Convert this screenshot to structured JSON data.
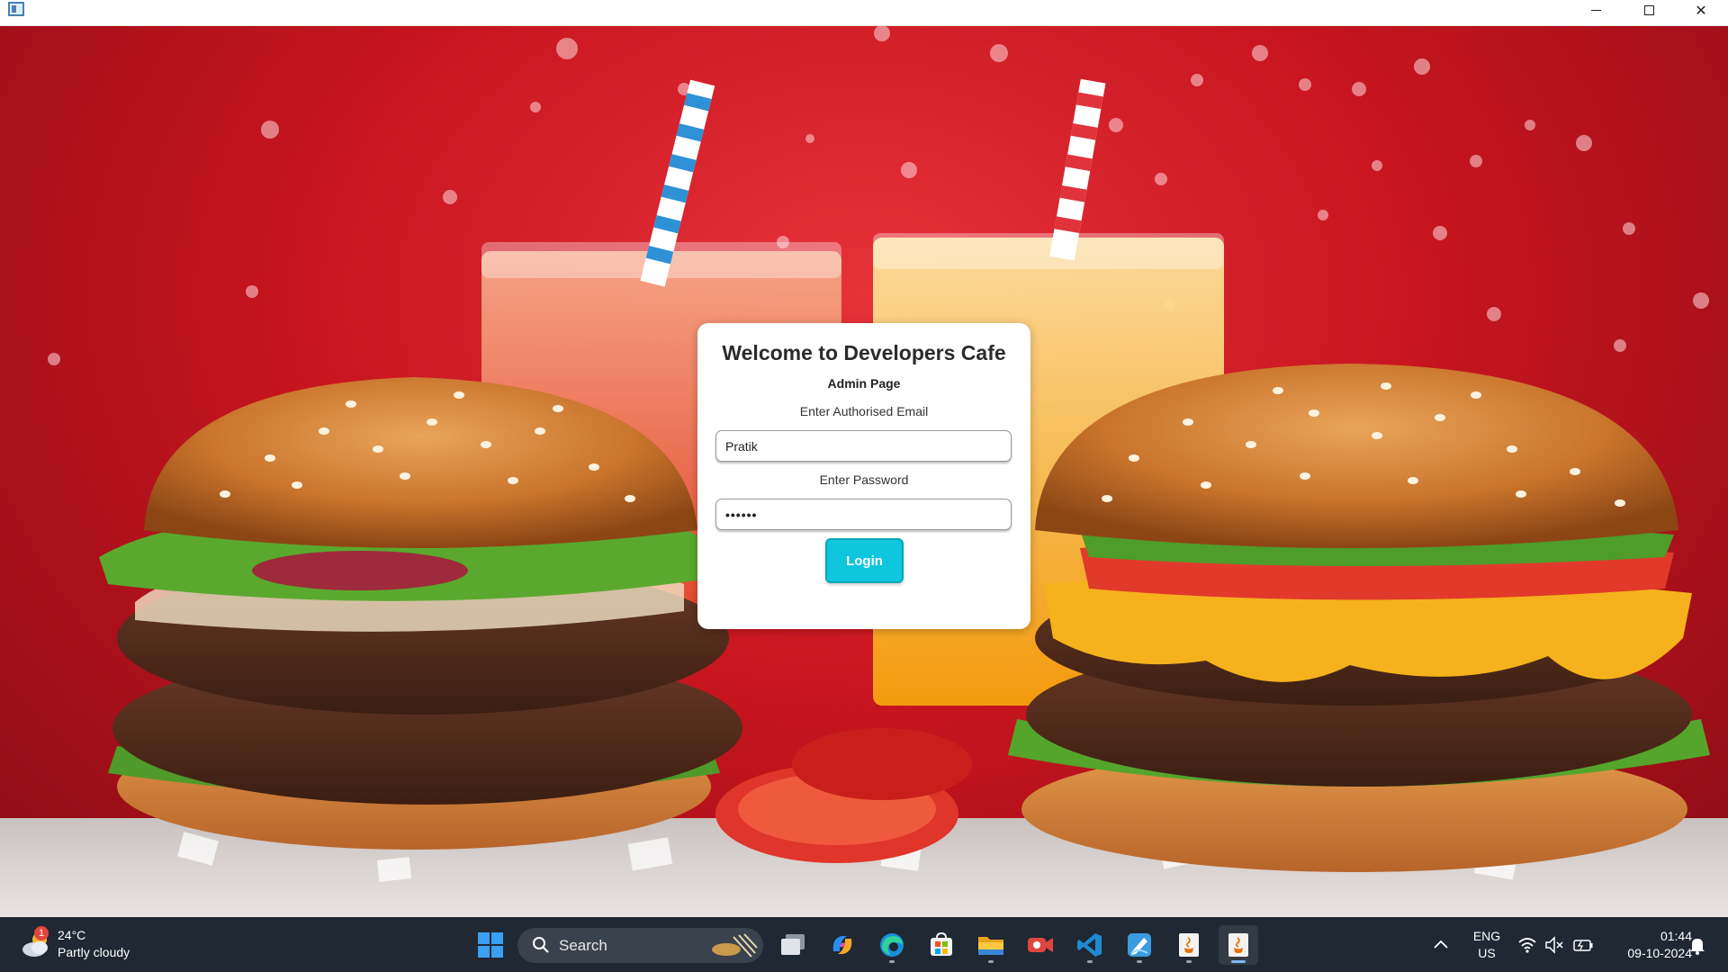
{
  "window": {
    "minimize_icon": "minimize-icon",
    "maximize_icon": "maximize-icon",
    "close_icon": "close-icon"
  },
  "login": {
    "title": "Welcome to Developers Cafe",
    "subtitle": "Admin Page",
    "email_label": "Enter Authorised Email",
    "email_value": "Pratik",
    "password_label": "Enter Password",
    "password_value": "••••••",
    "login_button": "Login",
    "accent_color": "#0ec6dd"
  },
  "taskbar": {
    "weather": {
      "temperature": "24°C",
      "condition": "Partly cloudy",
      "badge": "1"
    },
    "search_placeholder": "Search",
    "apps": [
      "windows-start-icon",
      "task-view-icon",
      "copilot-icon",
      "edge-icon",
      "microsoft-store-icon",
      "file-explorer-icon",
      "camera-app-icon",
      "vscode-icon",
      "sketch-app-icon",
      "java-app-icon",
      "java-app-active-icon"
    ],
    "language_line1": "ENG",
    "language_line2": "US",
    "time": "01:44",
    "date": "09-10-2024"
  }
}
